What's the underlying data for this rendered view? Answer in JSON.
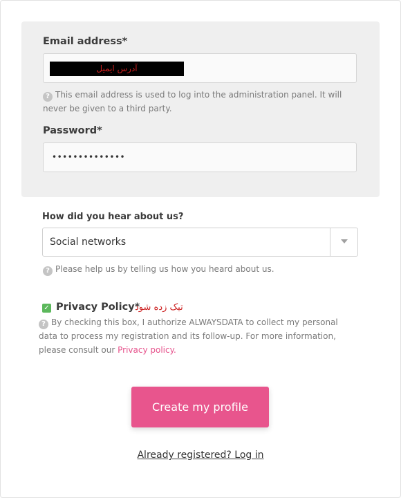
{
  "email": {
    "label": "Email address*",
    "value": "آدرس ایمیل",
    "help": "This email address is used to log into the administration panel. It will never be given to a third party."
  },
  "password": {
    "label": "Password*",
    "value": "••••••••••••••"
  },
  "referral": {
    "label": "How did you hear about us?",
    "selected": "Social networks",
    "help": "Please help us by telling us how you heard about us."
  },
  "privacy": {
    "label": "Privacy Policy*",
    "annotation": "تیک زده شود",
    "help_text": "By checking this box, I authorize ALWAYSDATA to collect my personal data to process my registration and its follow-up. For more information, please consult our",
    "link_text": "Privacy policy.",
    "checked": true
  },
  "actions": {
    "submit_label": "Create my profile",
    "login_link": "Already registered? Log in"
  },
  "icons": {
    "help": "question-circle-icon",
    "check": "checkmark-icon",
    "dropdown": "chevron-down-icon"
  },
  "colors": {
    "accent": "#e8558d",
    "checkbox": "#5cb85c",
    "annotation": "#cc1f1f"
  }
}
